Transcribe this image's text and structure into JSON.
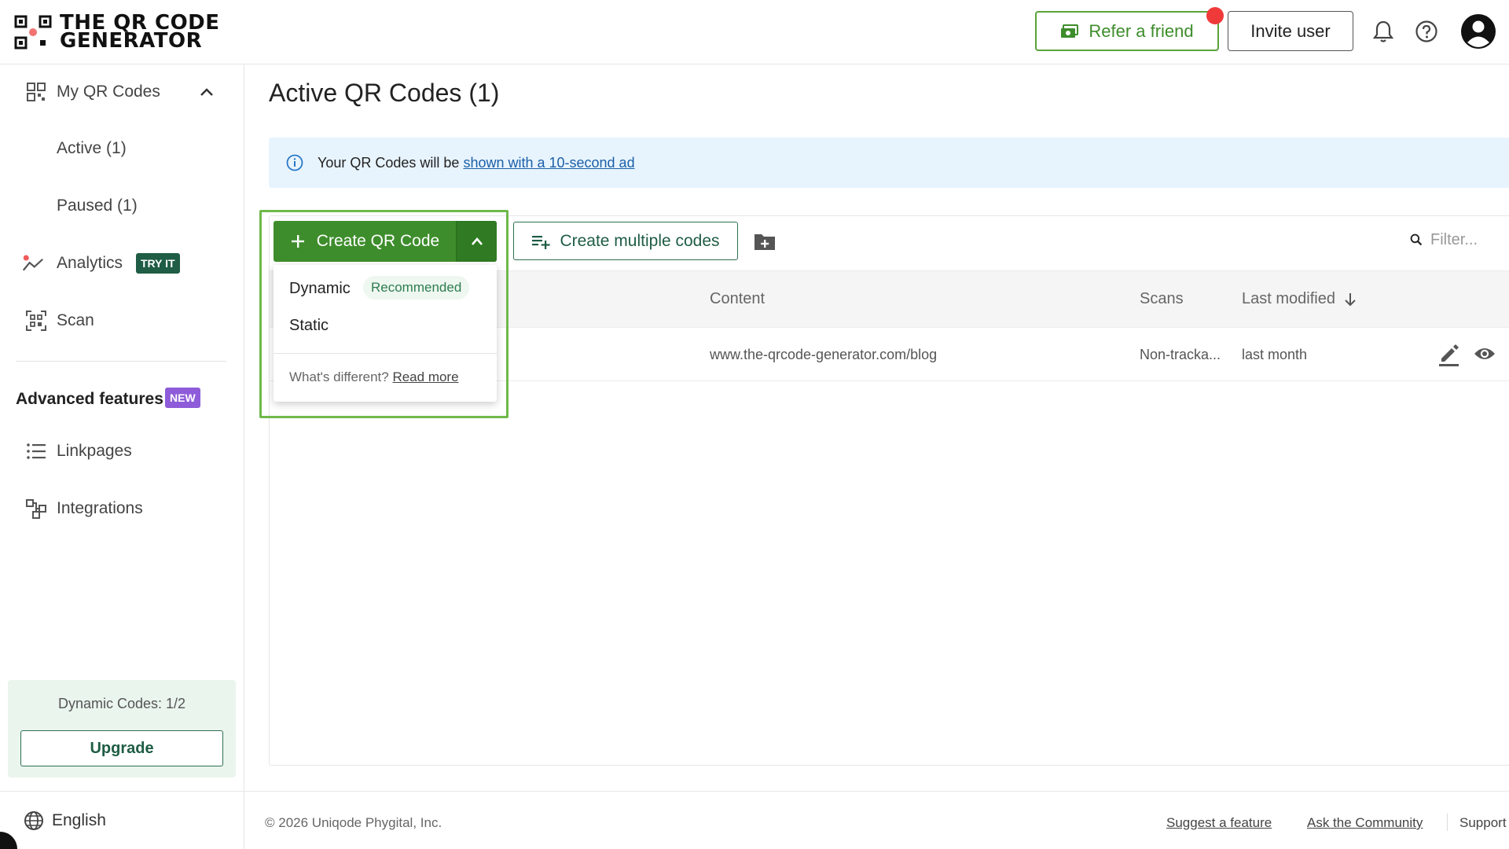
{
  "header": {
    "logo_line1": "THE QR CODE",
    "logo_line2": "GENERATOR",
    "refer_label": "Refer a friend",
    "invite_label": "Invite user"
  },
  "sidebar": {
    "my_qr_codes": "My QR Codes",
    "active": "Active (1)",
    "paused": "Paused (1)",
    "analytics": "Analytics",
    "analytics_badge": "TRY IT",
    "scan": "Scan",
    "advanced_title": "Advanced features",
    "advanced_badge": "NEW",
    "linkpages": "Linkpages",
    "integrations": "Integrations",
    "plan_text": "Dynamic Codes: 1/2",
    "upgrade_label": "Upgrade",
    "language": "English"
  },
  "main": {
    "title": "Active QR Codes (1)",
    "banner_text": "Your QR Codes will be ",
    "banner_link": "shown with a 10-second ad",
    "create_label": "Create QR Code",
    "multi_label": "Create multiple codes",
    "filter_placeholder": "Filter...",
    "dropdown": {
      "dynamic": "Dynamic",
      "recommended": "Recommended",
      "static": "Static",
      "whats_different": "What's different? ",
      "read_more": "Read more"
    },
    "columns": {
      "content": "Content",
      "scans": "Scans",
      "last_modified": "Last modified"
    },
    "rows": [
      {
        "content": "www.the-qrcode-generator.com/blog",
        "scans": "Non-tracka...",
        "last_modified": "last month"
      }
    ]
  },
  "footer": {
    "copyright": "© 2026 Uniqode Phygital, Inc.",
    "suggest": "Suggest a feature",
    "community": "Ask the Community",
    "support": "Support"
  },
  "colors": {
    "primary_green": "#3e8d2c",
    "dark_green": "#1f5d45",
    "banner_bg": "#e8f4fd",
    "badge_teal": "#1f5d45",
    "badge_purple": "#8e5cd9",
    "alert_red": "#f03a3a"
  },
  "icons": {
    "logo": "qr-logo-icon",
    "refer": "money-icon",
    "bell": "bell-icon",
    "help": "help-icon",
    "account": "account-icon",
    "my_qr": "qr-grid-icon",
    "analytics": "chart-line-icon",
    "scan": "scan-icon",
    "linkpages": "list-icon",
    "integrations": "integrations-icon",
    "language": "globe-icon",
    "info": "info-icon",
    "plus": "plus-icon",
    "chevron_up": "chevron-up-icon",
    "playlist_add": "playlist-add-icon",
    "folder_add": "folder-add-icon",
    "search": "search-icon",
    "arrow_down": "arrow-down-icon",
    "edit": "edit-icon",
    "view": "eye-icon"
  }
}
